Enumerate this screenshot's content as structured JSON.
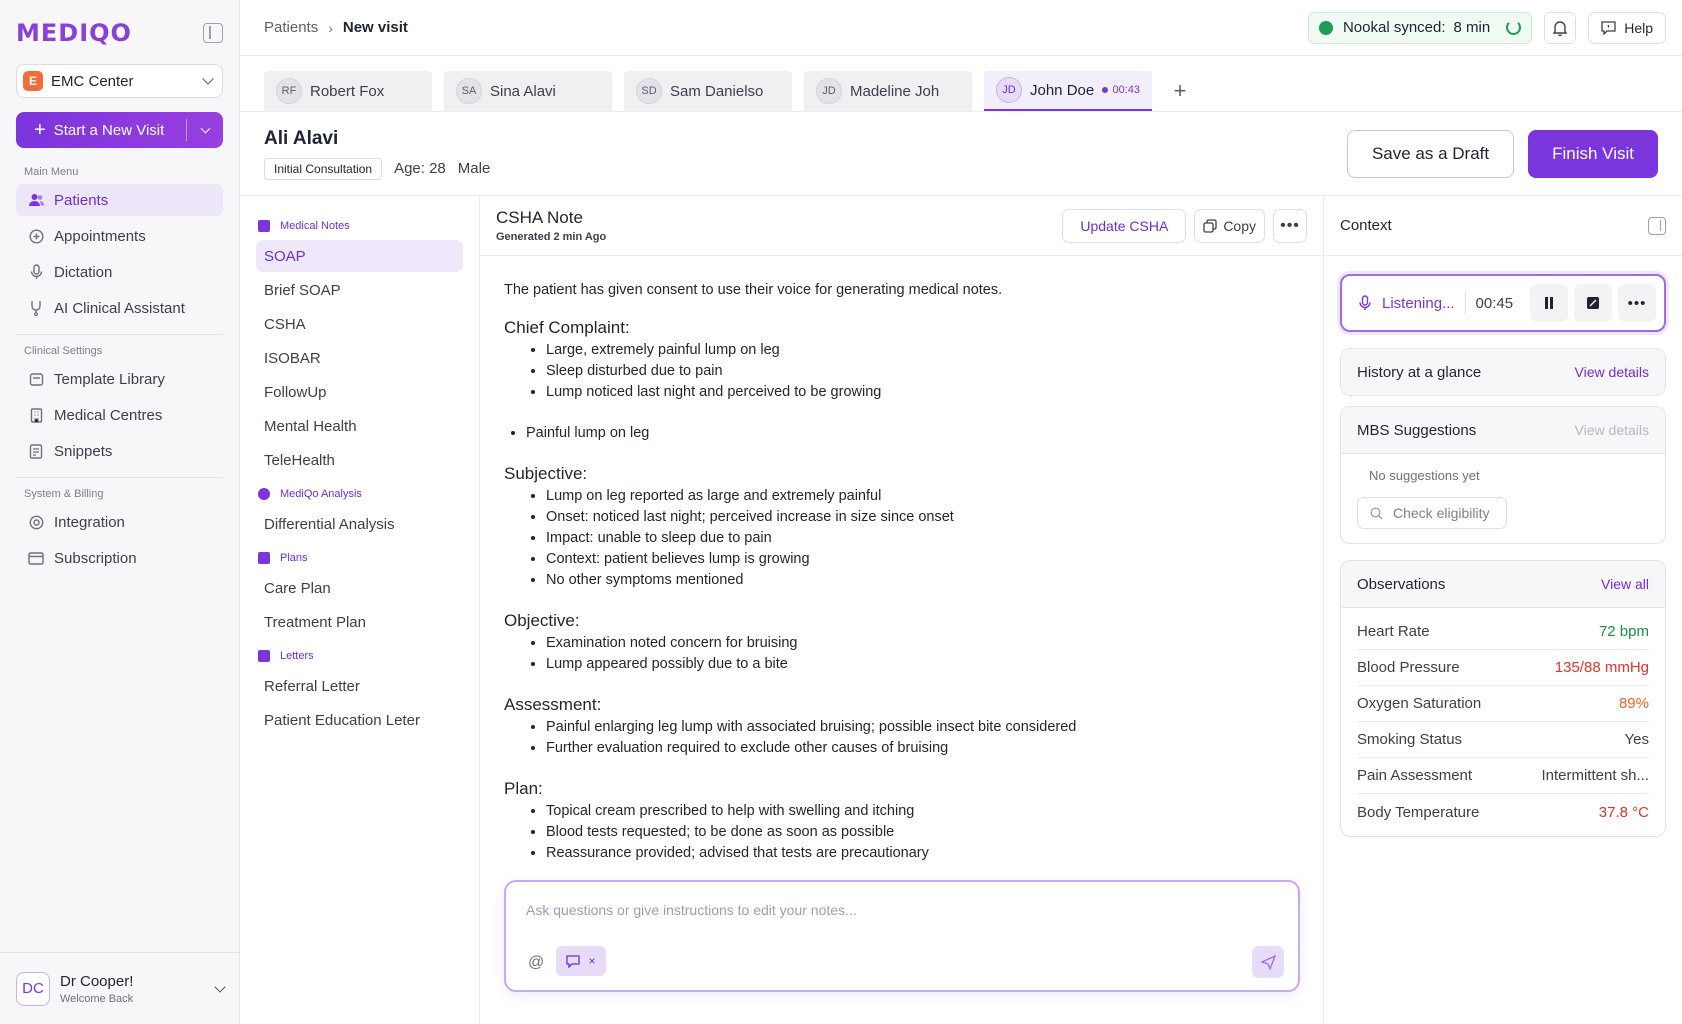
{
  "sidebar": {
    "logo": "MEDIQO",
    "center": {
      "badge": "E",
      "name": "EMC Center"
    },
    "new_visit_label": "Start a New Visit",
    "main_menu_title": "Main Menu",
    "main_menu": [
      {
        "label": "Patients",
        "icon": "users-icon",
        "active": true
      },
      {
        "label": "Appointments",
        "icon": "appointments-icon"
      },
      {
        "label": "Dictation",
        "icon": "microphone-icon"
      },
      {
        "label": "AI Clinical Assistant",
        "icon": "stethoscope-icon"
      }
    ],
    "clinical_title": "Clinical Settings",
    "clinical_menu": [
      {
        "label": "Template Library",
        "icon": "template-icon"
      },
      {
        "label": "Medical Centres",
        "icon": "building-icon"
      },
      {
        "label": "Snippets",
        "icon": "snippet-icon"
      }
    ],
    "system_title": "System & Billing",
    "system_menu": [
      {
        "label": "Integration",
        "icon": "integration-icon"
      },
      {
        "label": "Subscription",
        "icon": "card-icon"
      }
    ],
    "user": {
      "initials": "DC",
      "name": "Dr Cooper!",
      "subtitle": "Welcome Back"
    }
  },
  "topbar": {
    "breadcrumb_parent": "Patients",
    "breadcrumb_current": "New visit",
    "sync_label": "Nookal synced:",
    "sync_value": "8 min",
    "help_label": "Help"
  },
  "tabs": [
    {
      "initials": "RF",
      "name": "Robert Fox"
    },
    {
      "initials": "SA",
      "name": "Sina Alavi"
    },
    {
      "initials": "SD",
      "name": "Sam Danielso"
    },
    {
      "initials": "JD",
      "name": "Madeline Joh"
    },
    {
      "initials": "JD",
      "name": "John Doe",
      "timer": "00:43",
      "active": true
    }
  ],
  "patient": {
    "name": "Ali Alavi",
    "tag": "Initial Consultation",
    "age": "Age: 28",
    "gender": "Male",
    "draft_label": "Save as a Draft",
    "finish_label": "Finish Visit"
  },
  "notes_nav": {
    "medical_title": "Medical Notes",
    "medical": [
      "SOAP",
      "Brief SOAP",
      "CSHA",
      "ISOBAR",
      "FollowUp",
      "Mental Health",
      "TeleHealth"
    ],
    "analysis_title": "MediQo Analysis",
    "analysis": [
      "Differential Analysis"
    ],
    "plans_title": "Plans",
    "plans": [
      "Care Plan",
      "Treatment Plan"
    ],
    "letters_title": "Letters",
    "letters": [
      "Referral Letter",
      "Patient Education Leter"
    ]
  },
  "note": {
    "title": "CSHA Note",
    "subtitle": "Generated 2 min Ago",
    "update_label": "Update CSHA",
    "copy_label": "Copy",
    "consent": "The patient has given consent to use their voice for generating medical notes.",
    "chief_title": "Chief Complaint:",
    "chief": [
      "Large, extremely painful lump on leg",
      "Sleep disturbed due to pain",
      "Lump noticed last night and perceived to be growing"
    ],
    "extra": [
      "Painful lump on leg"
    ],
    "subjective_title": "Subjective:",
    "subjective": [
      "Lump on leg reported as large and extremely painful",
      "Onset: noticed last night; perceived increase in size since onset",
      "Impact: unable to sleep due to pain",
      "Context: patient believes lump is growing",
      "No other symptoms mentioned"
    ],
    "objective_title": "Objective:",
    "objective": [
      "Examination noted concern for bruising",
      "Lump appeared possibly due to a bite"
    ],
    "assessment_title": "Assessment:",
    "assessment": [
      "Painful enlarging leg lump with associated bruising; possible insect bite considered",
      "Further evaluation required to exclude other causes of bruising"
    ],
    "plan_title": "Plan:",
    "plan": [
      "Topical cream prescribed to help with swelling and itching",
      "Blood tests requested; to be done as soon as possible",
      "Reassurance provided; advised that tests are precautionary"
    ],
    "chat_placeholder": "Ask questions or give instructions to edit your notes..."
  },
  "context": {
    "title": "Context",
    "listening": "Listening...",
    "time": "00:45",
    "history_title": "History at a glance",
    "history_link": "View details",
    "mbs_title": "MBS Suggestions",
    "mbs_link": "View details",
    "mbs_empty": "No suggestions yet",
    "check_label": "Check eligibility",
    "obs_title": "Observations",
    "obs_link": "View all",
    "observations": [
      {
        "label": "Heart Rate",
        "value": "72 bpm",
        "color": "#1f8a4c"
      },
      {
        "label": "Blood Pressure",
        "value": "135/88 mmHg",
        "color": "#e0342b"
      },
      {
        "label": "Oxygen Saturation",
        "value": "89%",
        "color": "#f0642b"
      },
      {
        "label": "Smoking Status",
        "value": "Yes",
        "color": "#3b404c"
      },
      {
        "label": "Pain Assessment",
        "value": "Intermittent sh...",
        "color": "#3b404c"
      },
      {
        "label": "Body Temperature",
        "value": "37.8 °C",
        "color": "#e0342b"
      }
    ]
  }
}
